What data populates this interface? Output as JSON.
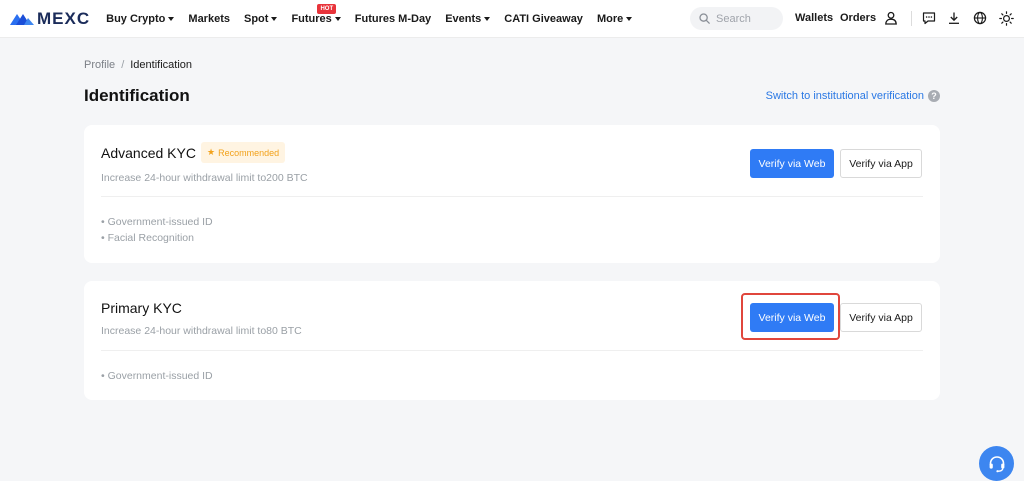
{
  "header": {
    "brand": "MEXC",
    "nav": [
      {
        "label": "Buy Crypto",
        "caret": true
      },
      {
        "label": "Markets",
        "caret": false
      },
      {
        "label": "Spot",
        "caret": true
      },
      {
        "label": "Futures",
        "caret": true,
        "badge": "HOT"
      },
      {
        "label": "Futures M-Day",
        "caret": false
      },
      {
        "label": "Events",
        "caret": true
      },
      {
        "label": "CATI Giveaway",
        "caret": false
      },
      {
        "label": "More",
        "caret": true
      }
    ],
    "search_placeholder": "Search",
    "wallets": "Wallets",
    "orders": "Orders"
  },
  "breadcrumb": {
    "parent": "Profile",
    "separator": "/",
    "current": "Identification"
  },
  "page_title": "Identification",
  "institutional_link": "Switch to institutional verification",
  "help_symbol": "?",
  "cards": {
    "advanced": {
      "title": "Advanced KYC",
      "badge": "Recommended",
      "badge_star": "★",
      "description": "Increase 24-hour withdrawal limit to200 BTC",
      "features": [
        "• Government-issued ID",
        "• Facial Recognition"
      ],
      "verify_web": "Verify via Web",
      "verify_app": "Verify via App"
    },
    "primary": {
      "title": "Primary KYC",
      "description": "Increase 24-hour withdrawal limit to80 BTC",
      "features": [
        "• Government-issued ID"
      ],
      "verify_web": "Verify via Web",
      "verify_app": "Verify via App"
    }
  },
  "colors": {
    "brand_blue": "#2f7bf5",
    "link_blue": "#2a78e4",
    "highlight_red": "#e0463c",
    "recommended_orange": "#f2a21c",
    "hot_red": "#e8343b"
  },
  "icons": [
    "mexc-logo-icon",
    "search-icon",
    "user-icon",
    "message-icon",
    "download-icon",
    "globe-icon",
    "theme-sun-icon",
    "help-icon",
    "star-icon",
    "headset-icon"
  ]
}
